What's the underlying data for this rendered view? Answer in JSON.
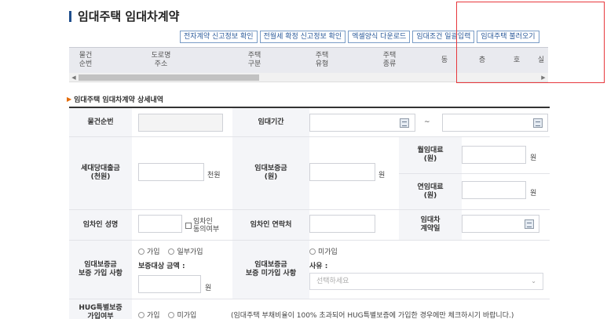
{
  "title": "임대주택 임대차계약",
  "buttons": [
    "전자계약 신고정보 확인",
    "전월세 확정 신고정보 확인",
    "엑셀양식 다운로드",
    "임대조건 일괄입력",
    "임대주택 불러오기"
  ],
  "list_columns": [
    "물건\n순번",
    "도로명\n주소",
    "주택\n구분",
    "주택\n유형",
    "주택\n종류",
    "동",
    "층",
    "호",
    "실"
  ],
  "section_title": "임대주택 임대차계약 상세내역",
  "form": {
    "item_no_label": "물건순번",
    "rent_period_label": "임대기간",
    "tilde": "~",
    "household_loan_label": "세대당대출금\n(천원)",
    "unit_thousand_won": "천원",
    "deposit_label": "임대보증금\n(원)",
    "unit_won": "원",
    "monthly_rent_label": "월임대료\n(원)",
    "yearly_rent_label": "연임대료\n(원)",
    "tenant_name_label": "임차인 성명",
    "tenant_consent_label": "임차인\n동의여부",
    "tenant_contact_label": "임차인 연락처",
    "contract_date_label": "임대차\n계약일",
    "insurance_join_label": "임대보증금\n보증 가입 사항",
    "insurance_join_options": [
      "가입",
      "일부가입"
    ],
    "insured_amount_label": "보증대상 금액 :",
    "insurance_nonjoin_label": "임대보증금\n보증 미가입 사항",
    "nonjoin_option": "미가입",
    "reason_label": "사유 :",
    "reason_placeholder": "선택하세요",
    "hug_label": "HUG특별보증\n가입여부",
    "hug_options": [
      "가입",
      "미가입"
    ],
    "hug_note": "(임대주택 부채비율이 100% 초과되어 HUG특별보증에 가입한 경우에만 체크하시기 바랍니다.)"
  }
}
